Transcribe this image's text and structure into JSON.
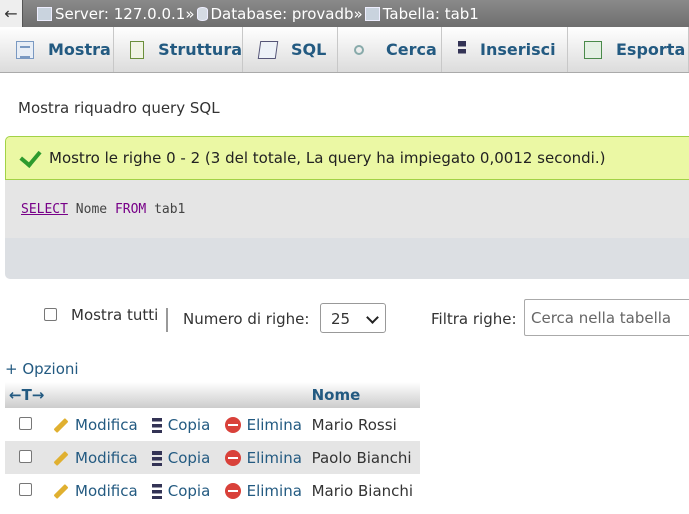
{
  "breadcrumb": {
    "back": "←",
    "server": "Server: 127.0.0.1",
    "sep": "»",
    "database": "Database: provadb",
    "table": "Tabella: tab1"
  },
  "tabs": [
    {
      "label": "Mostra",
      "icon": "browse-icon"
    },
    {
      "label": "Struttura",
      "icon": "structure-icon"
    },
    {
      "label": "SQL",
      "icon": "sql-icon"
    },
    {
      "label": "Cerca",
      "icon": "search-icon"
    },
    {
      "label": "Inserisci",
      "icon": "insert-icon"
    },
    {
      "label": "Esporta",
      "icon": "export-icon"
    }
  ],
  "query_toggle": "Mostra riquadro query SQL",
  "message": "Mostro le righe 0 - 2 (3 del totale, La query ha impiegato 0,0012 secondi.)",
  "sql": {
    "kw1": "SELECT",
    "col": " Nome ",
    "kw2": "FROM",
    "table": " tab1"
  },
  "controls": {
    "show_all": "Mostra tutti",
    "rows_label": "Numero di righe:",
    "rows_value": "25",
    "filter_label": "Filtra righe:",
    "filter_placeholder": "Cerca nella tabella"
  },
  "options_link": "+ Opzioni",
  "table": {
    "arrows": "←T→",
    "column": "Nome",
    "actions": {
      "edit": "Modifica",
      "copy": "Copia",
      "delete": "Elimina"
    },
    "rows": [
      "Mario Rossi",
      "Paolo Bianchi",
      "Mario Bianchi"
    ]
  },
  "colors": {
    "link": "#235a81",
    "success_bg": "#ebf8a4",
    "sql_keyword": "#770088"
  }
}
